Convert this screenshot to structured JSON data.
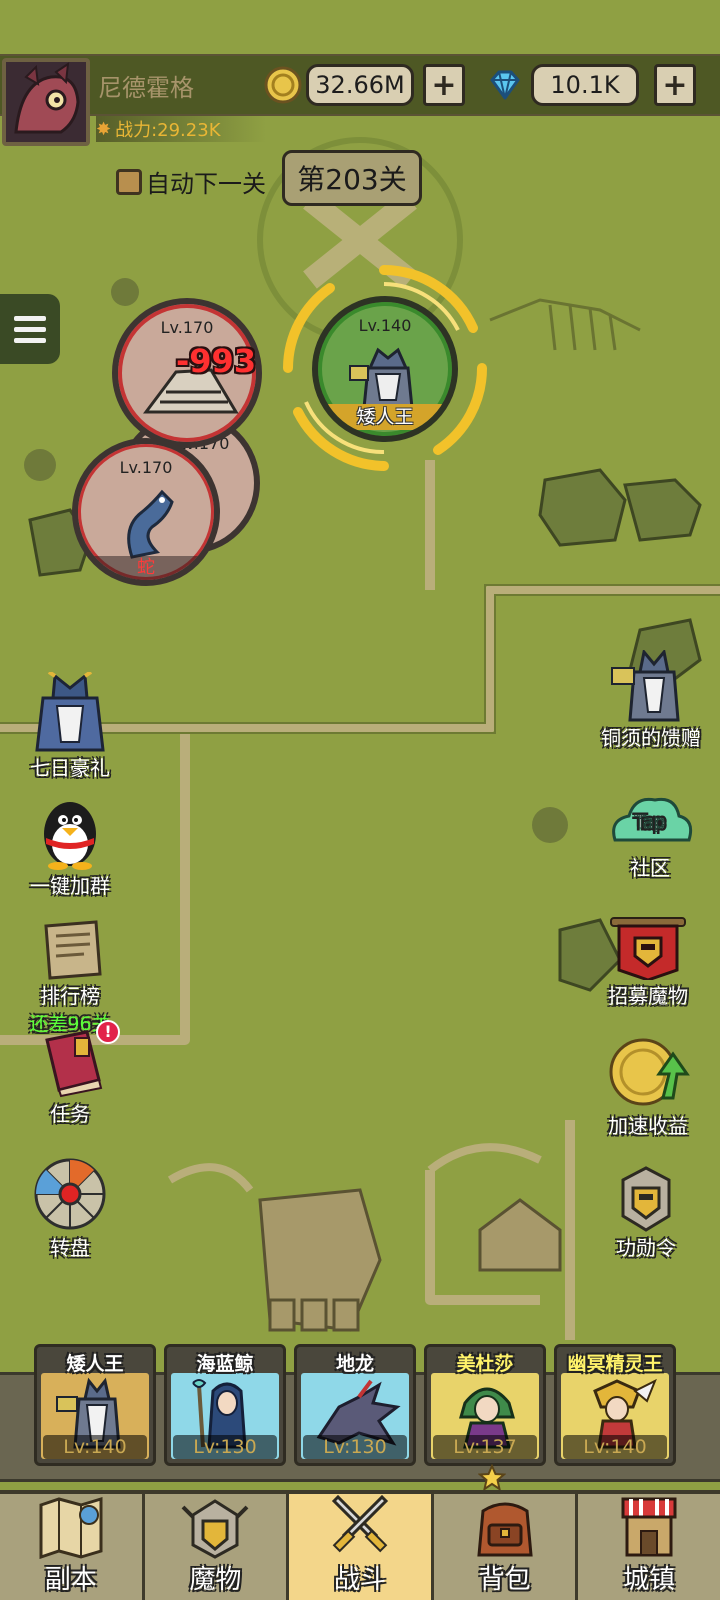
{
  "player": {
    "name": "尼德霍格",
    "power": "战力:29.23K"
  },
  "currency": {
    "gold": "32.66M",
    "gems": "10.1K",
    "plus": "+"
  },
  "stage": {
    "auto_next_label": "自动下一关",
    "level": "第203关"
  },
  "units": {
    "enemy1_level": "Lv.170",
    "enemy1_damage": "-993",
    "enemy2_level": "Lv.170",
    "enemy3_level": "Lv.170",
    "enemy3_name": "蛇",
    "boss_level": "Lv.140",
    "boss_name": "矮人王"
  },
  "left_buttons": [
    {
      "label": "七日豪礼",
      "icon": "dwarf-king-icon"
    },
    {
      "label": "一键加群",
      "icon": "penguin-icon"
    },
    {
      "label": "排行榜",
      "sub": "还差96关",
      "icon": "scroll-icon"
    },
    {
      "label": "任务",
      "icon": "book-icon"
    },
    {
      "label": "转盘",
      "icon": "wheel-icon"
    }
  ],
  "right_buttons": [
    {
      "label": "铜须的馈赠",
      "icon": "dwarf-king-icon"
    },
    {
      "label": "社区",
      "icon": "tap-community-icon"
    },
    {
      "label": "招募魔物",
      "icon": "banner-helmet-icon"
    },
    {
      "label": "加速收益",
      "icon": "coin-arrow-icon"
    },
    {
      "label": "功勋令",
      "icon": "helmet-badge-icon"
    }
  ],
  "heroes": [
    {
      "name": "矮人王",
      "level": "Lv:140",
      "name_color": "#ffffff",
      "bg": "#d8b05a"
    },
    {
      "name": "海蓝鲸",
      "level": "Lv:130",
      "name_color": "#ffffff",
      "bg": "#8fd8e8"
    },
    {
      "name": "地龙",
      "level": "Lv:130",
      "name_color": "#ffffff",
      "bg": "#8fd8e8"
    },
    {
      "name": "美杜莎",
      "level": "Lv:137",
      "name_color": "#fff36a",
      "bg": "#e8d36a"
    },
    {
      "name": "幽冥精灵王",
      "level": "Lv:140",
      "name_color": "#fff36a",
      "bg": "#e8d36a"
    }
  ],
  "nav": [
    {
      "label": "副本",
      "icon": "map-icon"
    },
    {
      "label": "魔物",
      "icon": "helmet-icon"
    },
    {
      "label": "战斗",
      "icon": "crossed-swords-icon",
      "active": true
    },
    {
      "label": "背包",
      "icon": "backpack-icon"
    },
    {
      "label": "城镇",
      "icon": "shop-icon"
    }
  ]
}
